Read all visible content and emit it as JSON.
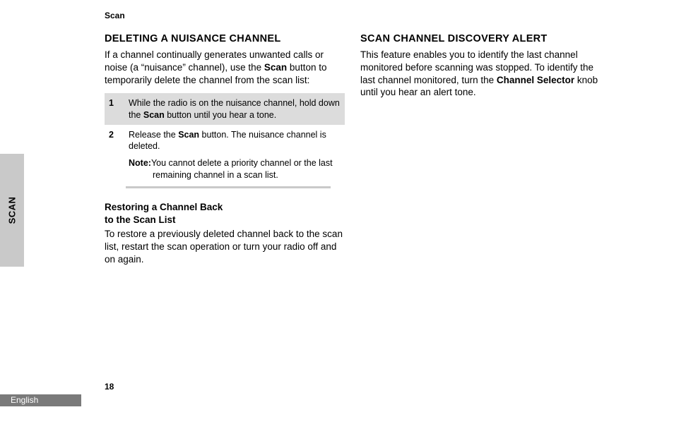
{
  "running_header": "Scan",
  "side_tab": "SCAN",
  "page_number": "18",
  "footer_language": "English",
  "left": {
    "title": "DELETING A NUISANCE CHANNEL",
    "intro_parts": [
      "If a channel continually generates unwanted calls or noise (a “nuisance” channel), use the ",
      "Scan",
      " button to temporarily delete the channel from the scan list:"
    ],
    "step1": {
      "num": "1",
      "parts": [
        "While the radio is on the nuisance channel, hold down the ",
        "Scan",
        " button until you hear a tone."
      ]
    },
    "step2": {
      "num": "2",
      "parts": [
        "Release the ",
        "Scan",
        " button. The nuisance chan­nel is deleted."
      ]
    },
    "note_label": "Note:",
    "note_body": "You cannot delete a priority channel or the last remaining channel in a scan list.",
    "sub_title_l1": "Restoring a Channel Back",
    "sub_title_l2": "to the Scan List",
    "restore_text": "To restore a previously deleted channel back to the scan list, restart the scan operation or turn your radio off and on again."
  },
  "right": {
    "title": "SCAN CHANNEL DISCOVERY ALERT",
    "parts": [
      "This feature enables you to identify the last channel monitored before scanning was stopped. To identify the last channel moni­tored, turn the ",
      "Channel Selector",
      " knob until you hear an alert tone."
    ]
  }
}
